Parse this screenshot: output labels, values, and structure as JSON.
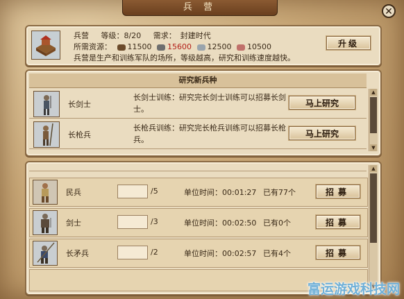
{
  "window": {
    "title": "兵 营",
    "close_glyph": "✕"
  },
  "building": {
    "name_label": "兵营",
    "level_label": "等级：",
    "level_value": "8/20",
    "require_label": "需求：",
    "require_value": "封建时代",
    "resources_label": "所需资源：",
    "resources": [
      {
        "icon": "wood-icon",
        "amount": "11500",
        "color": "#2a1a0c"
      },
      {
        "icon": "stone-icon",
        "amount": "15600",
        "color": "#b3201a"
      },
      {
        "icon": "iron-icon",
        "amount": "12500",
        "color": "#2a1a0c"
      },
      {
        "icon": "food-icon",
        "amount": "10500",
        "color": "#2a1a0c"
      }
    ],
    "description": "兵营是生产和训练军队的场所，等级越高，研究和训练速度越快。",
    "upgrade_label": "升级"
  },
  "research": {
    "header": "研究新兵种",
    "items": [
      {
        "name": "长剑士",
        "desc": "长剑士训练：研究完长剑士训练可以招募长剑士。",
        "button": "马上研究",
        "icon": "longsword-unit-icon"
      },
      {
        "name": "长枪兵",
        "desc": "长枪兵训练：研究完长枪兵训练可以招募长枪兵。",
        "button": "马上研究",
        "icon": "spearman-unit-icon"
      }
    ]
  },
  "recruit": {
    "time_label": "单位时间：",
    "rows": [
      {
        "name": "民兵",
        "max": "/5",
        "time": "00:01:27",
        "owned": "已有77个",
        "button": "招募",
        "icon": "militia-unit-icon"
      },
      {
        "name": "剑士",
        "max": "/3",
        "time": "00:02:50",
        "owned": "已有0个",
        "button": "招募",
        "icon": "swordsman-unit-icon"
      },
      {
        "name": "长矛兵",
        "max": "/2",
        "time": "00:02:57",
        "owned": "已有4个",
        "button": "招募",
        "icon": "pikeman-unit-icon"
      }
    ]
  },
  "watermark": "富运游戏科技网"
}
